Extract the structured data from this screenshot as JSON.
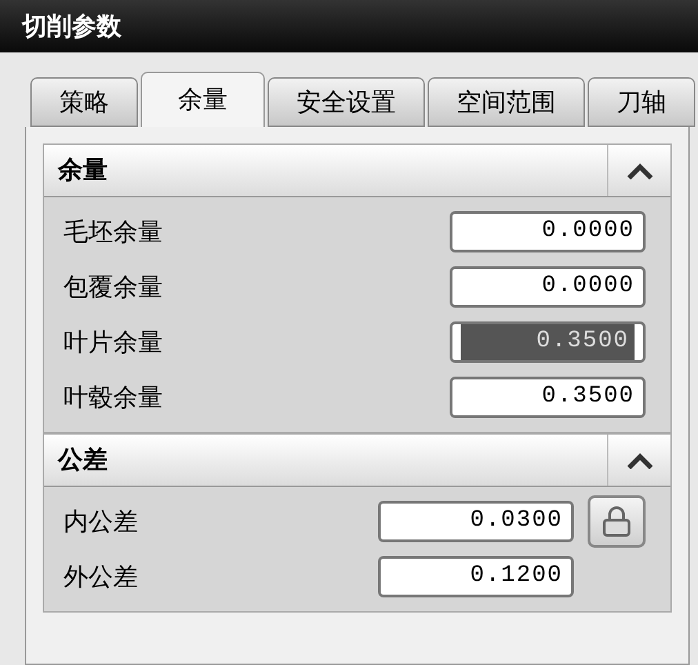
{
  "window": {
    "title": "切削参数"
  },
  "tabs": [
    {
      "label": "策略",
      "selected": false
    },
    {
      "label": "余量",
      "selected": true
    },
    {
      "label": "安全设置",
      "selected": false
    },
    {
      "label": "空间范围",
      "selected": false
    },
    {
      "label": "刀轴",
      "selected": false
    }
  ],
  "sections": [
    {
      "title": "余量",
      "expanded": true,
      "fields": [
        {
          "label": "毛坯余量",
          "value": "0.0000",
          "highlighted": false,
          "lock": false
        },
        {
          "label": "包覆余量",
          "value": "0.0000",
          "highlighted": false,
          "lock": false
        },
        {
          "label": "叶片余量",
          "value": "0.3500",
          "highlighted": true,
          "lock": false
        },
        {
          "label": "叶毂余量",
          "value": "0.3500",
          "highlighted": false,
          "lock": false
        }
      ]
    },
    {
      "title": "公差",
      "expanded": true,
      "fields": [
        {
          "label": "内公差",
          "value": "0.0300",
          "highlighted": false,
          "lock": true
        },
        {
          "label": "外公差",
          "value": "0.1200",
          "highlighted": false,
          "lock": false
        }
      ]
    }
  ]
}
